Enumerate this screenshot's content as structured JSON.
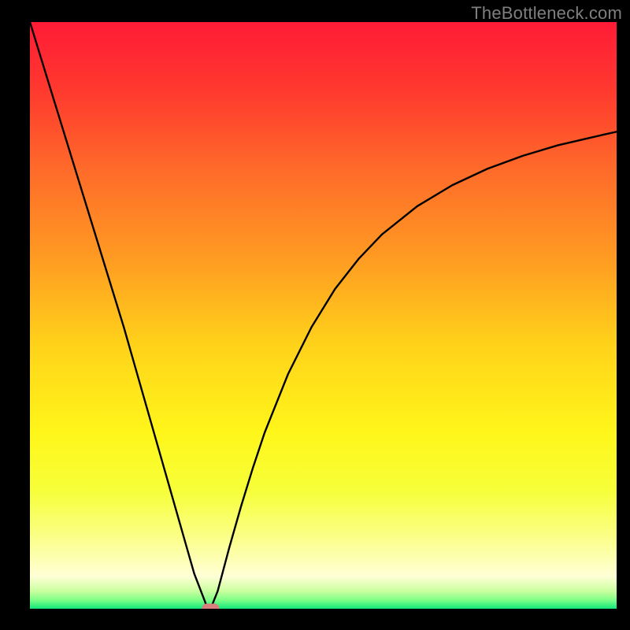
{
  "watermark": "TheBottleneck.com",
  "colors": {
    "background_black": "#000000",
    "watermark_gray": "#7f7f7f",
    "marker_pink": "#d97f7e",
    "curve": "#000000",
    "gradient_stops": [
      {
        "offset": 0.0,
        "color": "#ff1b36"
      },
      {
        "offset": 0.12,
        "color": "#ff3a2e"
      },
      {
        "offset": 0.25,
        "color": "#ff6a2a"
      },
      {
        "offset": 0.4,
        "color": "#ff9a22"
      },
      {
        "offset": 0.55,
        "color": "#ffd21a"
      },
      {
        "offset": 0.7,
        "color": "#fff61a"
      },
      {
        "offset": 0.8,
        "color": "#f6ff3a"
      },
      {
        "offset": 0.88,
        "color": "#fbff8a"
      },
      {
        "offset": 0.945,
        "color": "#ffffd6"
      },
      {
        "offset": 0.97,
        "color": "#c9ff9e"
      },
      {
        "offset": 0.985,
        "color": "#7fff88"
      },
      {
        "offset": 1.0,
        "color": "#12e67a"
      }
    ]
  },
  "chart_data": {
    "type": "line",
    "title": "",
    "xlabel": "",
    "ylabel": "",
    "xlim": [
      0,
      100
    ],
    "ylim": [
      0,
      100
    ],
    "x": [
      0,
      2,
      4,
      6,
      8,
      10,
      12,
      14,
      16,
      18,
      20,
      22,
      24,
      26,
      28,
      30,
      30.8,
      32,
      34,
      36,
      38,
      40,
      44,
      48,
      52,
      56,
      60,
      66,
      72,
      78,
      84,
      90,
      96,
      100
    ],
    "values": [
      100,
      93.5,
      87,
      80.5,
      74,
      67.5,
      61,
      54.5,
      48,
      41,
      34,
      27,
      20,
      13,
      6,
      0.8,
      0,
      3,
      10.5,
      17.5,
      24,
      30,
      40,
      48,
      54.5,
      59.6,
      63.8,
      68.6,
      72.2,
      75,
      77.2,
      79,
      80.4,
      81.3
    ],
    "marker": {
      "x": 30.8,
      "y": 0
    },
    "legend": [],
    "grid": false
  }
}
